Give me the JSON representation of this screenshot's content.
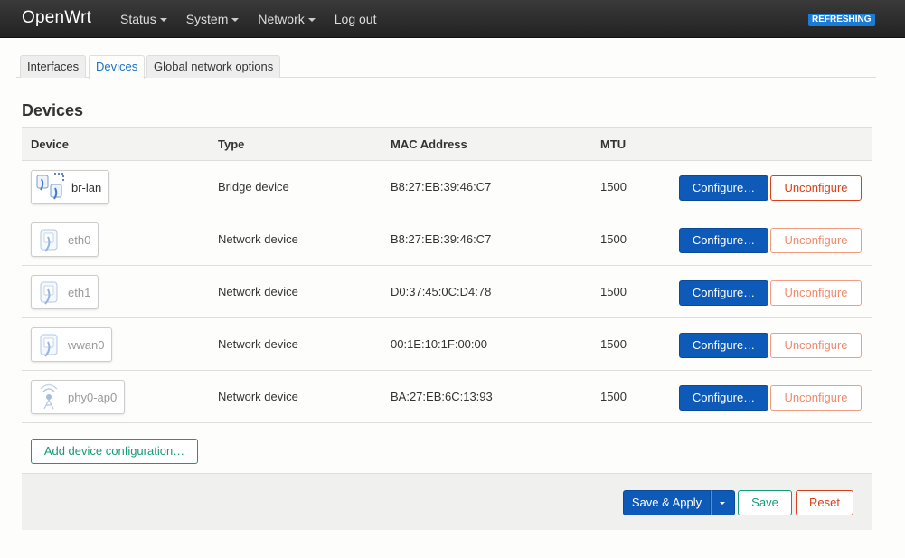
{
  "header": {
    "brand": "OpenWrt",
    "menu": [
      {
        "label": "Status",
        "dropdown": true
      },
      {
        "label": "System",
        "dropdown": true
      },
      {
        "label": "Network",
        "dropdown": true
      },
      {
        "label": "Log out",
        "dropdown": false
      }
    ],
    "status_badge": "REFRESHING"
  },
  "tabs": [
    {
      "label": "Interfaces",
      "active": false
    },
    {
      "label": "Devices",
      "active": true
    },
    {
      "label": "Global network options",
      "active": false
    }
  ],
  "section": {
    "title": "Devices",
    "columns": [
      "Device",
      "Type",
      "MAC Address",
      "MTU"
    ],
    "rows": [
      {
        "device": "br-lan",
        "icon": "bridge-icon",
        "type": "Bridge device",
        "mac": "B8:27:EB:39:46:C7",
        "mtu": "1500",
        "configure_label": "Configure…",
        "unconfigure_label": "Unconfigure",
        "active": true
      },
      {
        "device": "eth0",
        "icon": "ethernet-icon",
        "type": "Network device",
        "mac": "B8:27:EB:39:46:C7",
        "mtu": "1500",
        "configure_label": "Configure…",
        "unconfigure_label": "Unconfigure",
        "active": false
      },
      {
        "device": "eth1",
        "icon": "ethernet-icon",
        "type": "Network device",
        "mac": "D0:37:45:0C:D4:78",
        "mtu": "1500",
        "configure_label": "Configure…",
        "unconfigure_label": "Unconfigure",
        "active": false
      },
      {
        "device": "wwan0",
        "icon": "ethernet-icon",
        "type": "Network device",
        "mac": "00:1E:10:1F:00:00",
        "mtu": "1500",
        "configure_label": "Configure…",
        "unconfigure_label": "Unconfigure",
        "active": false
      },
      {
        "device": "phy0-ap0",
        "icon": "wifi-icon",
        "type": "Network device",
        "mac": "BA:27:EB:6C:13:93",
        "mtu": "1500",
        "configure_label": "Configure…",
        "unconfigure_label": "Unconfigure",
        "active": false
      }
    ],
    "add_button": "Add device configuration…"
  },
  "footer": {
    "save_apply": "Save & Apply",
    "save": "Save",
    "reset": "Reset"
  },
  "colors": {
    "primary": "#0e5ab8",
    "positive": "#159a7a",
    "negative": "#d9401a",
    "badge": "#1a7cd6",
    "topbar": "#2a2a2a"
  }
}
